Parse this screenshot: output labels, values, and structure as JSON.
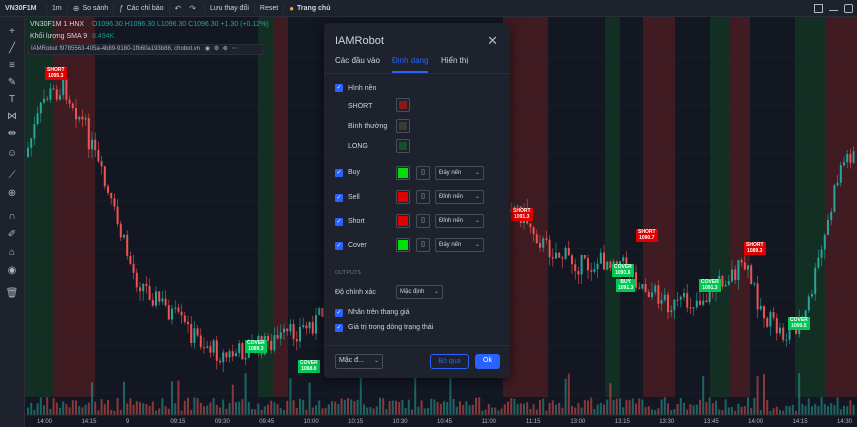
{
  "toolbar": {
    "symbol": "VN30F1M",
    "interval": "1m",
    "compare": "So sánh",
    "indicators": "Các chỉ báo",
    "save": "Lưu thay đổi",
    "reset": "Reset",
    "home": "Trang chủ"
  },
  "legend": {
    "symbol_line": "VN30F1M  1  HNX",
    "ohlc": "O1096.30 H1096.30 L1096.30 C1096.30 +1.30 (+0.12%)",
    "volume_label": "Khối lượng SMA 9",
    "volume_value": "8.494K",
    "indicator_line": "IAMRobot f9785563-405a-4b89-9180-1fb60a193b88, chobot.vn"
  },
  "signals": [
    {
      "label": "SHORT",
      "price": "1095.3",
      "color": "red"
    },
    {
      "label": "COVER",
      "price": "1089.3",
      "color": "green"
    },
    {
      "label": "COVER",
      "price": "1088.8",
      "color": "green"
    },
    {
      "label": "SHORT",
      "price": "1091.3",
      "color": "red"
    },
    {
      "label": "COVER",
      "price": "1091.6",
      "color": "green"
    },
    {
      "label": "BUY",
      "price": "1091.3",
      "color": "green"
    },
    {
      "label": "SHORT",
      "price": "1090.7",
      "color": "red"
    },
    {
      "label": "COVER",
      "price": "1091.3",
      "color": "green"
    },
    {
      "label": "SHORT",
      "price": "1089.3",
      "color": "red"
    },
    {
      "label": "COVER",
      "price": "1090.5",
      "color": "green"
    }
  ],
  "time_axis": [
    "14:00",
    "14:15",
    "9",
    "09:15",
    "09:30",
    "09:45",
    "10:00",
    "10:15",
    "10:30",
    "10:45",
    "11:00",
    "11:15",
    "13:00",
    "13:15",
    "13:30",
    "13:45",
    "14:00",
    "14:15",
    "14:30"
  ],
  "dialog": {
    "title": "IAMRobot",
    "tabs": [
      "Các đầu vào",
      "Định dạng",
      "Hiển thị"
    ],
    "background_label": "Hình nền",
    "bg_rows": [
      {
        "label": "SHORT",
        "color": "#8b1a1a"
      },
      {
        "label": "Bình thường",
        "color": "#3a3a3a"
      },
      {
        "label": "LONG",
        "color": "#1a4d2a"
      }
    ],
    "style_rows": [
      {
        "label": "Buy",
        "color": "#00e000",
        "position": "Đáy nến"
      },
      {
        "label": "Sell",
        "color": "#e00000",
        "position": "Đỉnh nến"
      },
      {
        "label": "Short",
        "color": "#e00000",
        "position": "Đỉnh nến"
      },
      {
        "label": "Cover",
        "color": "#00e000",
        "position": "Đáy nến"
      }
    ],
    "outputs_header": "OUTPUTS",
    "precision_label": "Độ chính xác",
    "precision_value": "Mặc định",
    "checkbox_labels": [
      "Nhãn trên thang giá",
      "Giá trị trong dòng trạng thái"
    ],
    "defaults_label": "Mặc đ...",
    "cancel": "Bỏ qua",
    "ok": "Ok"
  },
  "colors": {
    "bg": "#131722",
    "up": "#26a69a",
    "down": "#ef5350",
    "short_zone": "#4a1c22",
    "long_zone": "#143322",
    "accent": "#2962ff"
  }
}
